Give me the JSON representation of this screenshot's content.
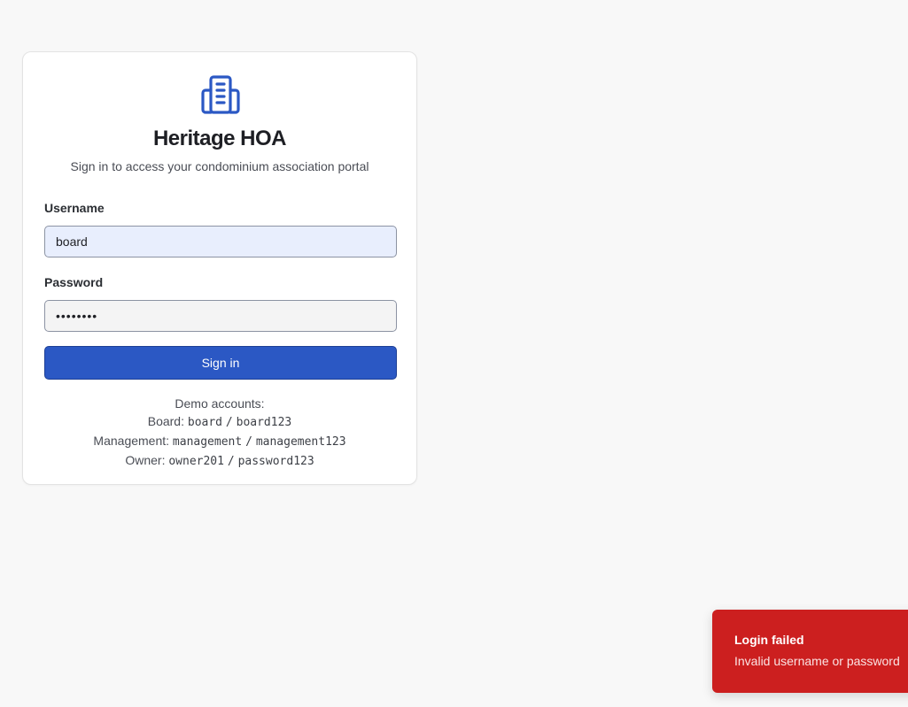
{
  "app": {
    "title": "Heritage HOA",
    "subtitle": "Sign in to access your condominium association portal",
    "logo_icon": "building-icon",
    "accent_color": "#2b58c4"
  },
  "form": {
    "username_label": "Username",
    "username_value": "board",
    "password_label": "Password",
    "password_value": "board123",
    "submit_label": "Sign in"
  },
  "demo": {
    "heading": "Demo accounts:",
    "accounts": [
      {
        "role": "Board:",
        "username": "board",
        "separator": "/",
        "password": "board123"
      },
      {
        "role": "Management:",
        "username": "management",
        "separator": "/",
        "password": "management123"
      },
      {
        "role": "Owner:",
        "username": "owner201",
        "separator": "/",
        "password": "password123"
      }
    ]
  },
  "toast": {
    "title": "Login failed",
    "message": "Invalid username or password",
    "color": "#cc1f1f"
  }
}
